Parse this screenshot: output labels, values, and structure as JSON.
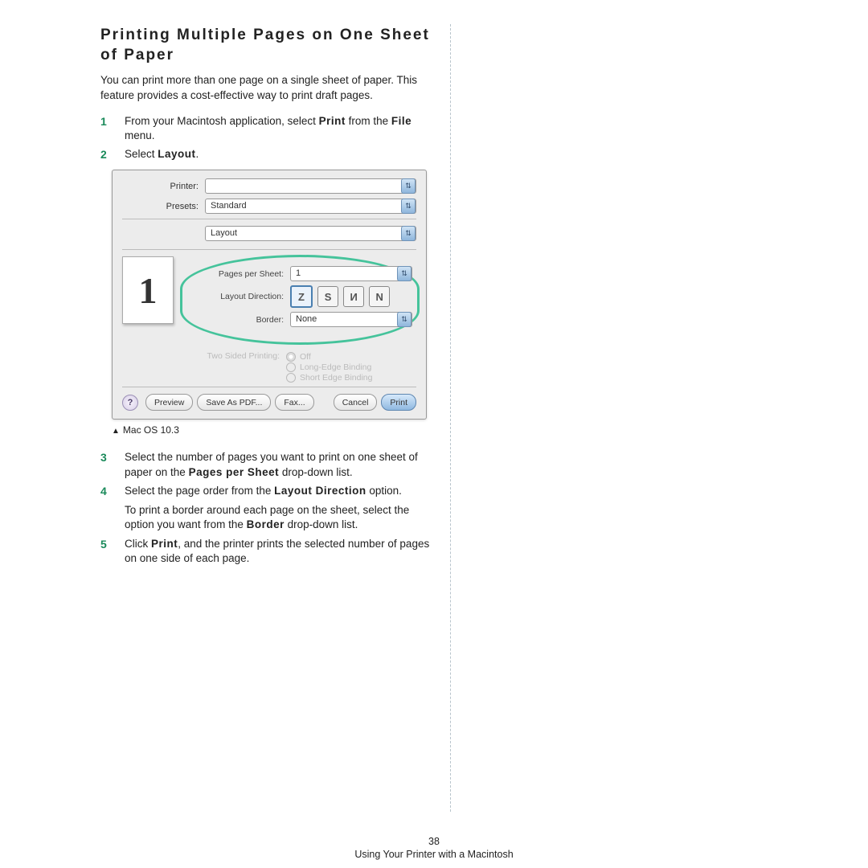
{
  "title_line1": "Printing Multiple Pages on One Sheet",
  "title_line2": "of Paper",
  "intro": "You can print more than one page on a single sheet of paper. This feature provides a cost-effective way to print draft pages.",
  "steps_top": [
    {
      "n": "1",
      "pre": "From your Macintosh application, select ",
      "b": "Print",
      "post": " from the ",
      "b2": "File",
      "post2": " menu."
    },
    {
      "n": "2",
      "pre": "Select ",
      "b": "Layout",
      "post": "."
    }
  ],
  "dialog": {
    "printer_label": "Printer:",
    "printer_value": "",
    "presets_label": "Presets:",
    "presets_value": "Standard",
    "section_value": "Layout",
    "pps_label": "Pages per Sheet:",
    "pps_value": "1",
    "dir_label": "Layout Direction:",
    "border_label": "Border:",
    "border_value": "None",
    "twosided_label": "Two Sided Printing:",
    "twosided_opts": [
      "Off",
      "Long-Edge Binding",
      "Short Edge Binding"
    ],
    "preview_num": "1",
    "buttons": {
      "help": "?",
      "preview": "Preview",
      "save": "Save As PDF...",
      "fax": "Fax...",
      "cancel": "Cancel",
      "print": "Print"
    }
  },
  "caption": "Mac OS 10.3",
  "steps_bottom": [
    {
      "n": "3",
      "pre": "Select the number of pages you want to print on one sheet of paper on the ",
      "b": "Pages per Sheet",
      "post": " drop-down list."
    },
    {
      "n": "4",
      "pre": "Select the page order from the ",
      "b": "Layout Direction",
      "post": " option.",
      "extra_pre": "To print a border around each page on the sheet, select the option you want from the ",
      "extra_b": "Border",
      "extra_post": " drop-down list."
    },
    {
      "n": "5",
      "pre": "Click ",
      "b": "Print",
      "post": ", and the printer prints the selected number of pages on one side of each page."
    }
  ],
  "footer": {
    "page": "38",
    "chapter": "Using Your Printer with a Macintosh"
  }
}
